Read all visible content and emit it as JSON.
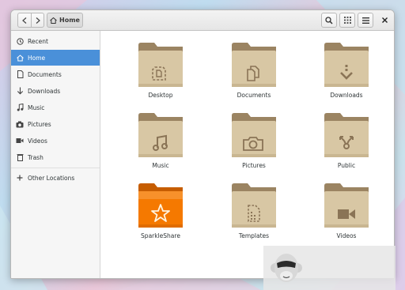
{
  "header": {
    "path_label": "Home",
    "back_icon": "go-back-icon",
    "forward_icon": "go-forward-icon",
    "search_icon": "search-icon",
    "view_icon": "grid-view-icon",
    "menu_icon": "hamburger-menu-icon",
    "close_icon": "close-icon"
  },
  "sidebar": {
    "items": [
      {
        "label": "Recent",
        "icon": "clock-icon"
      },
      {
        "label": "Home",
        "icon": "home-icon",
        "active": true
      },
      {
        "label": "Documents",
        "icon": "document-icon"
      },
      {
        "label": "Downloads",
        "icon": "download-arrow-icon"
      },
      {
        "label": "Music",
        "icon": "music-note-icon"
      },
      {
        "label": "Pictures",
        "icon": "camera-icon"
      },
      {
        "label": "Videos",
        "icon": "video-camera-icon"
      },
      {
        "label": "Trash",
        "icon": "trash-icon"
      },
      {
        "label": "Other Locations",
        "icon": "plus-icon"
      }
    ]
  },
  "folders": [
    {
      "label": "Desktop",
      "emblem": "desktop-emblem-icon"
    },
    {
      "label": "Documents",
      "emblem": "documents-emblem-icon"
    },
    {
      "label": "Downloads",
      "emblem": "download-emblem-icon"
    },
    {
      "label": "Music",
      "emblem": "music-emblem-icon"
    },
    {
      "label": "Pictures",
      "emblem": "camera-emblem-icon"
    },
    {
      "label": "Public",
      "emblem": "share-emblem-icon"
    },
    {
      "label": "SparkleShare",
      "emblem": "star-emblem-icon",
      "highlight": true
    },
    {
      "label": "Templates",
      "emblem": "template-emblem-icon"
    },
    {
      "label": "Videos",
      "emblem": "video-emblem-icon"
    }
  ],
  "colors": {
    "folder": "#d8c7a4",
    "folder_dark": "#9b8462",
    "sparkleshare": "#f57900",
    "selection": "#4a90d9"
  }
}
